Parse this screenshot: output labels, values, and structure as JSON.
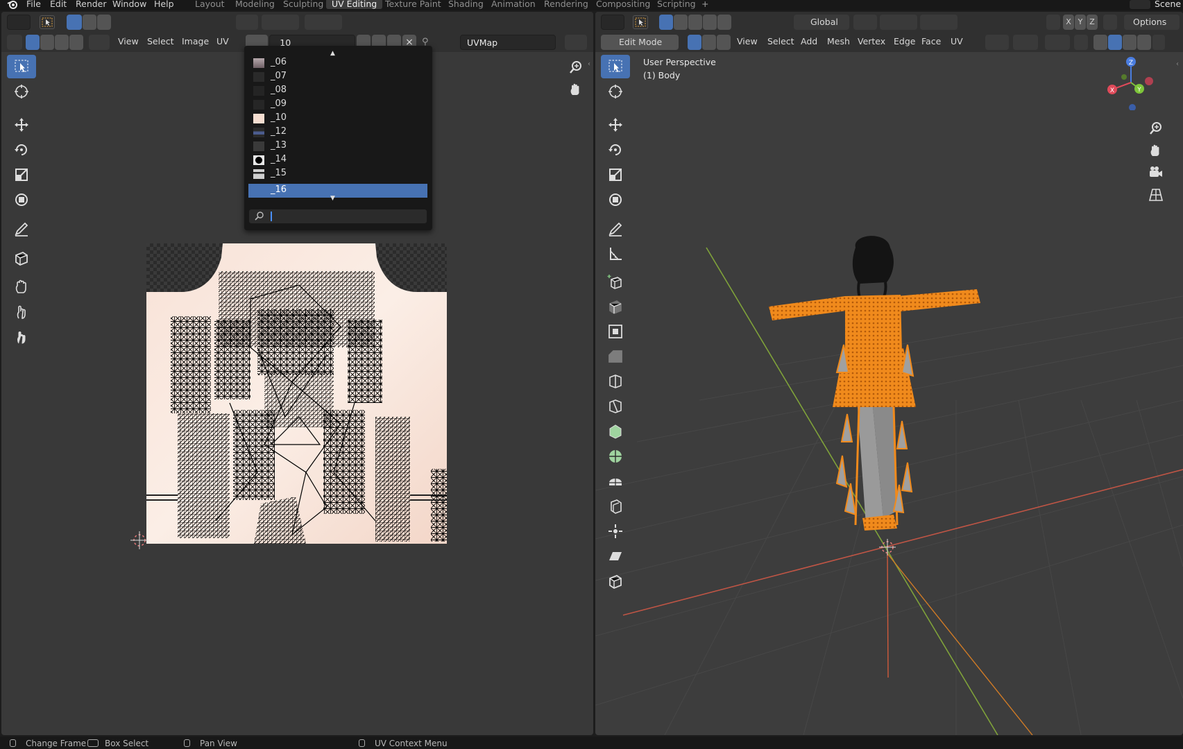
{
  "menu": {
    "items": [
      "File",
      "Edit",
      "Render",
      "Window",
      "Help"
    ],
    "workspaces": [
      "Layout",
      "Modeling",
      "Sculpting",
      "UV Editing",
      "Texture Paint",
      "Shading",
      "Animation",
      "Rendering",
      "Compositing",
      "Scripting"
    ],
    "active_workspace": "UV Editing",
    "scene_label": "Scene"
  },
  "uv_editor": {
    "header_menus": [
      "View",
      "Select",
      "Image",
      "UV"
    ],
    "image_name": "_10",
    "uvmap_name": "UVMap",
    "image_list": [
      {
        "name": "_06",
        "swatch": "#b7a9ad"
      },
      {
        "name": "_07",
        "swatch": "#2a2a2a"
      },
      {
        "name": "_08",
        "swatch": "#242424"
      },
      {
        "name": "_09",
        "swatch": "#262626"
      },
      {
        "name": "_10",
        "swatch": "#f5ddd0"
      },
      {
        "name": "_12",
        "swatch": "#4b5c8e"
      },
      {
        "name": "_13",
        "swatch": "#3a3a3a"
      },
      {
        "name": "_14",
        "swatch": "#e8e8e8"
      },
      {
        "name": "_15",
        "swatch": "#cfcfcf"
      },
      {
        "name": "_16",
        "swatch": "#4772b3"
      }
    ],
    "selected_image": "_16",
    "search_value": ""
  },
  "viewport": {
    "mode": "Edit Mode",
    "header_menus": [
      "View",
      "Select",
      "Add",
      "Mesh",
      "Vertex",
      "Edge",
      "Face",
      "UV"
    ],
    "orientation": "Global",
    "options_label": "Options",
    "axis_buttons": [
      "X",
      "Y",
      "Z"
    ],
    "overlay_title": "User Perspective",
    "overlay_object": "(1) Body",
    "gizmo_labels": [
      "Z",
      "X",
      "Y"
    ]
  },
  "statusbar": {
    "items": [
      "Change Frame",
      "Box Select",
      "Pan View",
      "UV Context Menu"
    ]
  },
  "colors": {
    "accent": "#4772b3",
    "selection_orange": "#f08a1c",
    "header": "#303030",
    "editor_bg": "#393939"
  }
}
